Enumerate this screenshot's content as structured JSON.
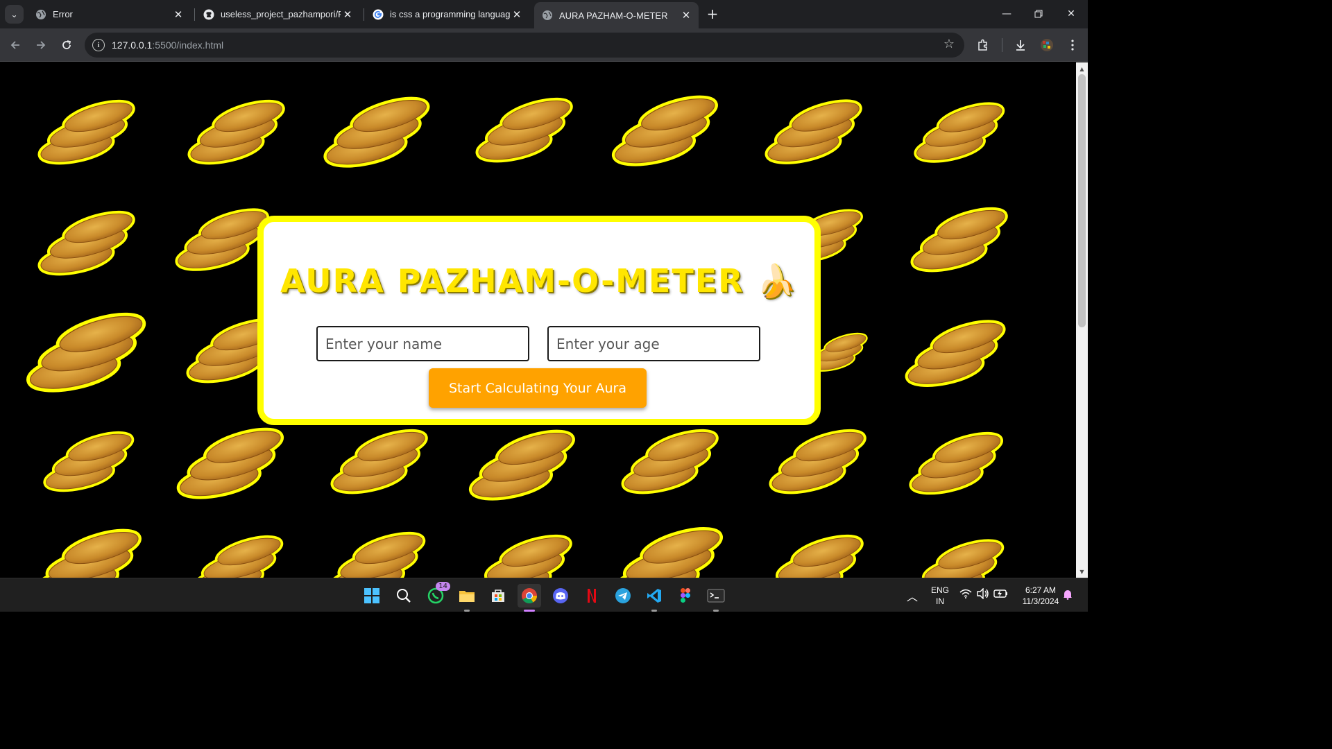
{
  "browser": {
    "tabs": [
      {
        "title": "Error",
        "favicon": "globe-icon",
        "active": false
      },
      {
        "title": "useless_project_pazhampori/RE",
        "favicon": "github-icon",
        "active": false
      },
      {
        "title": "is css a programming language",
        "favicon": "google-icon",
        "active": false
      },
      {
        "title": "AURA PAZHAM-O-METER",
        "favicon": "globe-icon",
        "active": true
      }
    ],
    "url_host": "127.0.0.1",
    "url_rest": ":5500/index.html"
  },
  "page": {
    "title": "AURA PAZHAM-O-METER 🍌",
    "name_placeholder": "Enter your name",
    "age_placeholder": "Enter your age",
    "start_button": "Start Calculating Your Aura",
    "colors": {
      "background": "#000000",
      "card_border": "#ffff00",
      "title": "#ffe600",
      "button": "#ffa200"
    }
  },
  "taskbar": {
    "whatsapp_badge": "14",
    "lang_line1": "ENG",
    "lang_line2": "IN",
    "time": "6:27 AM",
    "date": "11/3/2024"
  }
}
